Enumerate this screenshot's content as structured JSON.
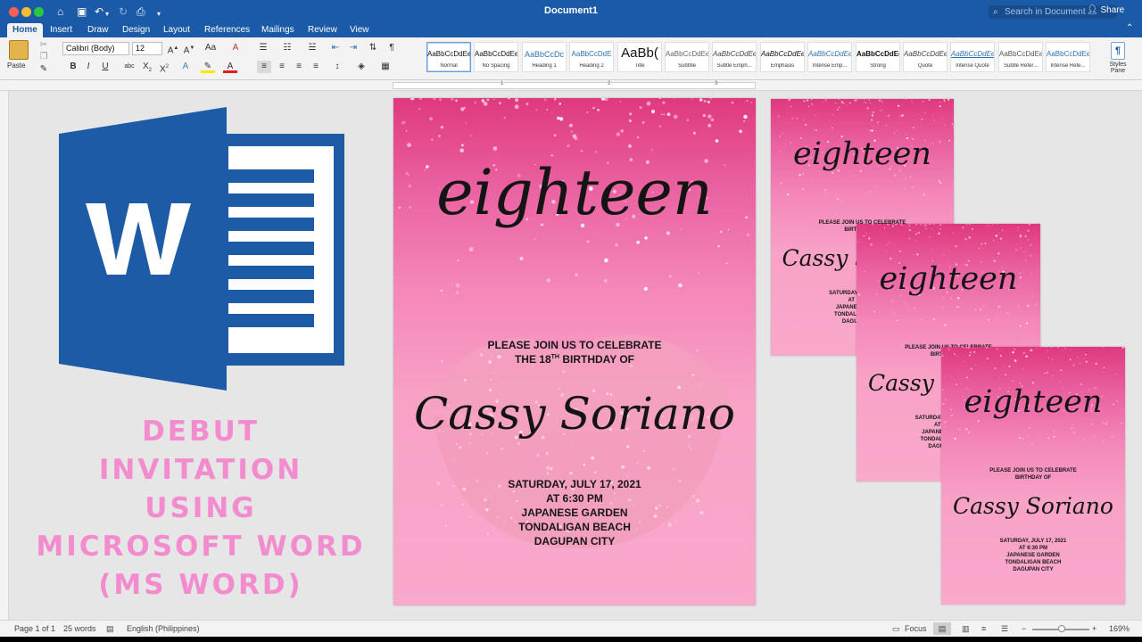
{
  "window": {
    "title": "Document1",
    "search_placeholder": "Search in Document",
    "share_label": "Share"
  },
  "tabs": [
    {
      "label": "Home",
      "active": true
    },
    {
      "label": "Insert"
    },
    {
      "label": "Draw"
    },
    {
      "label": "Design"
    },
    {
      "label": "Layout"
    },
    {
      "label": "References"
    },
    {
      "label": "Mailings"
    },
    {
      "label": "Review"
    },
    {
      "label": "View"
    }
  ],
  "ribbon": {
    "paste_label": "Paste",
    "font_name": "Calibri (Body)",
    "font_size": "12",
    "styles": [
      {
        "preview": "AaBbCcDdEe",
        "name": "Normal"
      },
      {
        "preview": "AaBbCcDdEe",
        "name": "No Spacing"
      },
      {
        "preview": "AaBbCcDc",
        "name": "Heading 1"
      },
      {
        "preview": "AaBbCcDdE",
        "name": "Heading 2"
      },
      {
        "preview": "AaBb(",
        "name": "Title"
      },
      {
        "preview": "AaBbCcDdEe",
        "name": "Subtitle"
      },
      {
        "preview": "AaBbCcDdEe",
        "name": "Subtle Emph..."
      },
      {
        "preview": "AaBbCcDdEe",
        "name": "Emphasis"
      },
      {
        "preview": "AaBbCcDdEe",
        "name": "Intense Emp..."
      },
      {
        "preview": "AaBbCcDdEe",
        "name": "Strong"
      },
      {
        "preview": "AaBbCcDdEe",
        "name": "Quote"
      },
      {
        "preview": "AaBbCcDdEe",
        "name": "Intense Quote"
      },
      {
        "preview": "AaBbCcDdEe",
        "name": "Subtle Refer..."
      },
      {
        "preview": "AaBbCcDdEe",
        "name": "Intense Refe..."
      }
    ],
    "styles_pane_label": "Styles Pane"
  },
  "promo": {
    "lines": [
      "DEBUT",
      "INVITATION",
      "USING",
      "MICROSOFT WORD",
      "(MS WORD)"
    ],
    "color": "#f38ccf"
  },
  "invitation": {
    "script_title": "eighteen",
    "join_line1": "PLEASE JOIN US TO CELEBRATE",
    "join_line2_prefix": "THE 18",
    "join_line2_sup": "TH",
    "join_line2_suffix": " BIRTHDAY OF",
    "name": "Cassy Soriano",
    "date": "SATURDAY, JULY 17, 2021",
    "time": "AT 6:30 PM",
    "venue1": "JAPANESE GARDEN",
    "venue2": "TONDALIGAN BEACH",
    "venue3": "DAGUPAN CITY"
  },
  "status": {
    "page": "Page 1 of 1",
    "words": "25 words",
    "language": "English (Philippines)",
    "focus": "Focus",
    "zoom": "169%"
  },
  "colors": {
    "titlebar": "#1b5aa6",
    "invite_pink": "#f9a9cb",
    "word_blue": "#1d5ba7"
  }
}
